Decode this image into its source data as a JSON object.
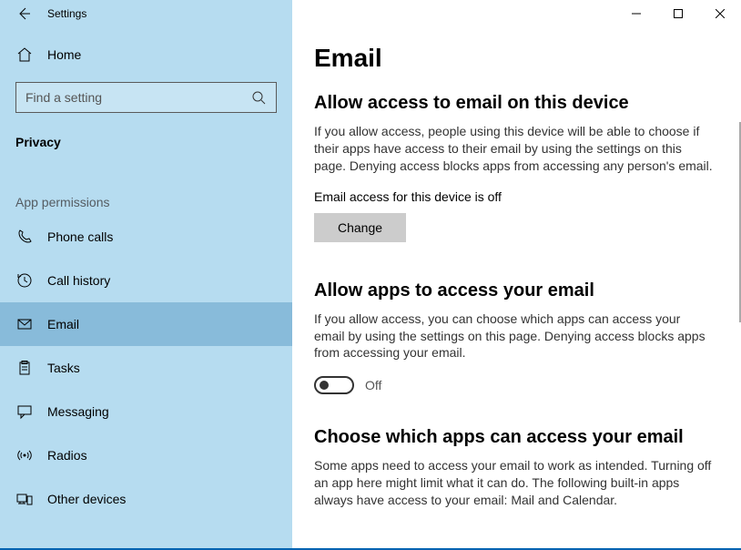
{
  "window": {
    "title": "Settings"
  },
  "sidebar": {
    "home": "Home",
    "search_placeholder": "Find a setting",
    "category": "Privacy",
    "section": "App permissions",
    "items": [
      {
        "label": "Phone calls",
        "icon": "phone"
      },
      {
        "label": "Call history",
        "icon": "history"
      },
      {
        "label": "Email",
        "icon": "mail",
        "selected": true
      },
      {
        "label": "Tasks",
        "icon": "tasks"
      },
      {
        "label": "Messaging",
        "icon": "message"
      },
      {
        "label": "Radios",
        "icon": "radio"
      },
      {
        "label": "Other devices",
        "icon": "devices"
      }
    ]
  },
  "content": {
    "title": "Email",
    "section1": {
      "heading": "Allow access to email on this device",
      "desc": "If you allow access, people using this device will be able to choose if their apps have access to their email by using the settings on this page. Denying access blocks apps from accessing any person's email.",
      "status": "Email access for this device is off",
      "change_btn": "Change"
    },
    "section2": {
      "heading": "Allow apps to access your email",
      "desc": "If you allow access, you can choose which apps can access your email by using the settings on this page. Denying access blocks apps from accessing your email.",
      "toggle_state": "Off"
    },
    "section3": {
      "heading": "Choose which apps can access your email",
      "desc": "Some apps need to access your email to work as intended. Turning off an app here might limit what it can do. The following built-in apps always have access to your email: Mail and Calendar."
    }
  }
}
